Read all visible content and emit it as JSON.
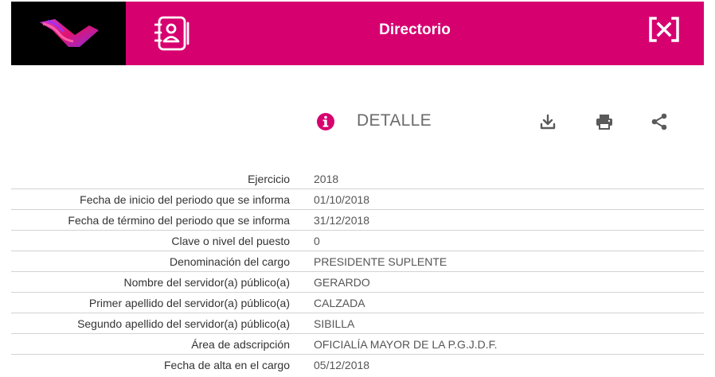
{
  "header": {
    "title": "Directorio",
    "bg_color": "#d6006f",
    "logo_icon": "institution-logo",
    "directory_icon": "contact-book-icon",
    "close_icon": "close-icon"
  },
  "detail": {
    "label": "DETALLE",
    "info_icon": "info-icon",
    "actions": [
      "download-icon",
      "print-icon",
      "share-icon"
    ]
  },
  "rows": [
    {
      "label": "Ejercicio",
      "value": "2018"
    },
    {
      "label": "Fecha de inicio del periodo que se informa",
      "value": "01/10/2018"
    },
    {
      "label": "Fecha de término del periodo que se informa",
      "value": "31/12/2018"
    },
    {
      "label": "Clave o nivel del puesto",
      "value": "0"
    },
    {
      "label": "Denominación del cargo",
      "value": "PRESIDENTE SUPLENTE"
    },
    {
      "label": "Nombre del servidor(a) público(a)",
      "value": "GERARDO"
    },
    {
      "label": "Primer apellido del servidor(a) público(a)",
      "value": "CALZADA"
    },
    {
      "label": "Segundo apellido del servidor(a) público(a)",
      "value": "SIBILLA"
    },
    {
      "label": "Área de adscripción",
      "value": "OFICIALÍA MAYOR DE LA P.G.J.D.F."
    },
    {
      "label": "Fecha de alta en el cargo",
      "value": "05/12/2018"
    }
  ]
}
